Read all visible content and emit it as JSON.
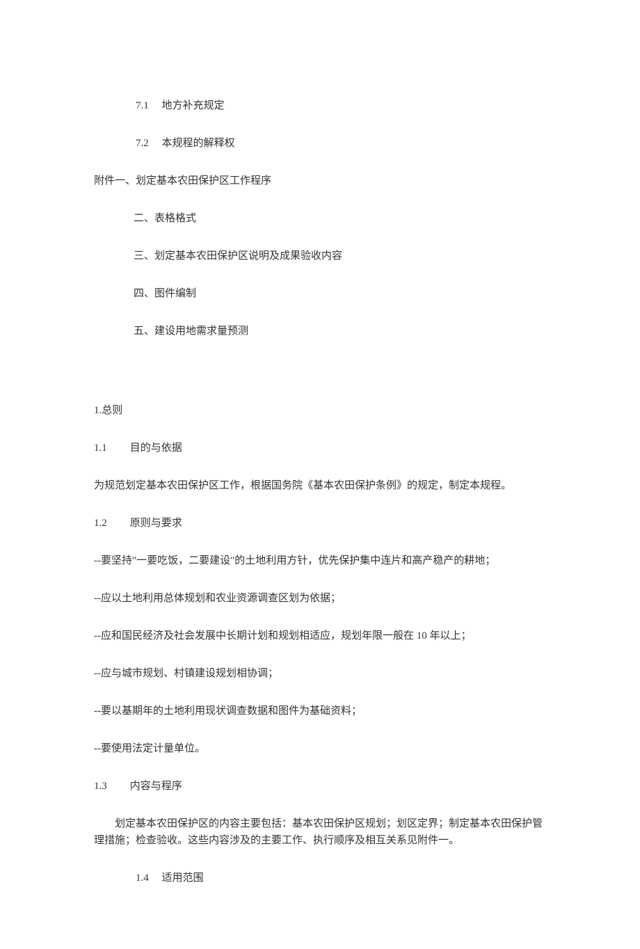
{
  "toc": {
    "item_7_1": {
      "num": "7.1",
      "title": "地方补充规定"
    },
    "item_7_2": {
      "num": "7.2",
      "title": "本规程的解释权"
    },
    "appendix_label": "附件一、",
    "appendix_1": "划定基本农田保护区工作程序",
    "appendix_2": "二、表格格式",
    "appendix_3": "三、划定基本农田保护区说明及成果验收内容",
    "appendix_4": "四、图件编制",
    "appendix_5": "五、建设用地需求量预测"
  },
  "section1": {
    "heading": "1.总则",
    "s1_1": {
      "num": "1.1",
      "title": "目的与依据"
    },
    "p1_1": "为规范划定基本农田保护区工作，根据国务院《基本农田保护条例》的规定，制定本规程。",
    "s1_2": {
      "num": "1.2",
      "title": "原则与要求"
    },
    "bullets": {
      "b1": "--要坚持\"一要吃饭，二要建设\"的土地利用方针，优先保护集中连片和高产稳产的耕地；",
      "b2": "--应以土地利用总体规划和农业资源调查区划为依据；",
      "b3": "--应和国民经济及社会发展中长期计划和规划相适应，规划年限一般在 10 年以上；",
      "b4": "--应与城市规划、村镇建设规划相协调；",
      "b5": "--要以基期年的土地利用现状调查数据和图件为基础资料；",
      "b6": "--要使用法定计量单位。"
    },
    "s1_3": {
      "num": "1.3",
      "title": "内容与程序"
    },
    "p1_3": "划定基本农田保护区的内容主要包括：基本农田保护区规划；划区定界；制定基本农田保护管理措施；检查验收。这些内容涉及的主要工作、执行顺序及相互关系见附件一。",
    "s1_4": {
      "num": "1.4",
      "title": "适用范围"
    }
  }
}
